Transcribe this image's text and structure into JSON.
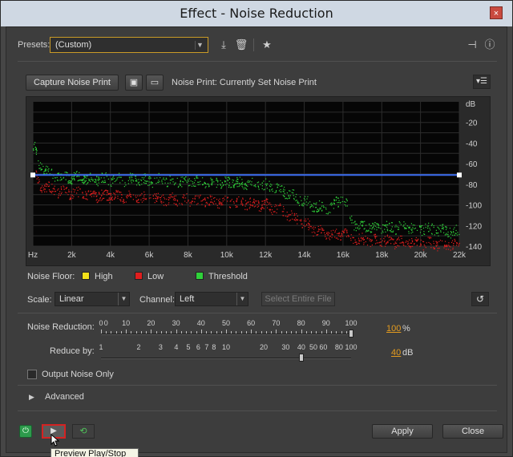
{
  "window": {
    "title": "Effect - Noise Reduction",
    "close_glyph": "×"
  },
  "presets": {
    "label": "Presets:",
    "selected": "(Custom)",
    "icons": [
      "save-preset-icon",
      "delete-preset-icon",
      "favorite-star-icon",
      "routing-icon",
      "info-icon"
    ]
  },
  "capture": {
    "button_label": "Capture Noise Print",
    "noise_print_label": "Noise Print: Currently Set Noise Print"
  },
  "colors": {
    "high": "#f2e01a",
    "low": "#e01e1e",
    "threshold": "#2fd13a",
    "curve": "#3a6cf0",
    "accent_value": "#e39b1f"
  },
  "chart_data": {
    "type": "scatter",
    "x_label_ticks": [
      "Hz",
      "2k",
      "4k",
      "6k",
      "8k",
      "10k",
      "12k",
      "14k",
      "16k",
      "18k",
      "20k",
      "22k"
    ],
    "y_unit": "dB",
    "y_ticks": [
      "-20",
      "-40",
      "-60",
      "-80",
      "-100",
      "-120",
      "-140"
    ],
    "ylim": [
      -140,
      0
    ],
    "xlim": [
      0,
      22000
    ],
    "grid": true,
    "series": [
      {
        "name": "Threshold",
        "color": "#2fd13a",
        "x_khz": [
          0.1,
          0.3,
          0.6,
          1,
          1.5,
          2,
          3,
          4,
          5,
          6,
          7,
          8,
          9,
          10,
          11,
          12,
          12.5,
          13,
          13.5,
          14,
          14.5,
          15,
          15.5,
          16,
          16.5,
          17,
          18,
          19,
          20,
          21,
          22
        ],
        "db": [
          -45,
          -60,
          -65,
          -70,
          -72,
          -73,
          -74,
          -75,
          -75,
          -76,
          -76,
          -77,
          -77,
          -78,
          -79,
          -81,
          -83,
          -87,
          -92,
          -97,
          -100,
          -104,
          -100,
          -92,
          -118,
          -120,
          -122,
          -121,
          -122,
          -124,
          -126
        ]
      },
      {
        "name": "Low",
        "color": "#e01e1e",
        "x_khz": [
          0.1,
          0.3,
          0.6,
          1,
          1.5,
          2,
          3,
          4,
          5,
          6,
          7,
          8,
          9,
          10,
          11,
          12,
          12.5,
          13,
          13.5,
          14,
          14.5,
          15,
          15.5,
          16,
          16.5,
          17,
          18,
          19,
          20,
          21,
          22
        ],
        "db": [
          -70,
          -80,
          -82,
          -85,
          -87,
          -88,
          -90,
          -91,
          -92,
          -93,
          -94,
          -95,
          -96,
          -97,
          -98,
          -100,
          -103,
          -107,
          -112,
          -118,
          -124,
          -128,
          -130,
          -126,
          -132,
          -134,
          -135,
          -136,
          -137,
          -138,
          -139
        ]
      },
      {
        "name": "High",
        "color": "#f2e01a",
        "x_khz": [],
        "db": []
      },
      {
        "name": "Noise Reduction Curve",
        "color": "#3a6cf0",
        "x_khz": [
          0,
          22
        ],
        "db": [
          -71,
          -71
        ]
      }
    ]
  },
  "legend": {
    "noise_floor_label": "Noise Floor:",
    "high": "High",
    "low": "Low",
    "threshold": "Threshold"
  },
  "controls": {
    "scale_label": "Scale:",
    "scale_value": "Linear",
    "channel_label": "Channel:",
    "channel_value": "Left",
    "select_entire_file": "Select Entire File"
  },
  "noise_reduction": {
    "label": "Noise Reduction:",
    "ticks": [
      "0",
      "0",
      "10",
      "20",
      "30",
      "40",
      "50",
      "60",
      "70",
      "80",
      "90",
      "100"
    ],
    "value": "100",
    "unit": "%",
    "fraction": 1.0
  },
  "reduce_by": {
    "label": "Reduce by:",
    "ticks": [
      "1",
      "2",
      "3",
      "4",
      "5",
      "6",
      "7",
      "8",
      "10",
      "20",
      "30",
      "40",
      "50",
      "60",
      "80",
      "100"
    ],
    "value": "40",
    "unit": "dB",
    "fraction": 0.8
  },
  "output_noise_only": {
    "label": "Output Noise Only",
    "checked": false
  },
  "advanced": {
    "label": "Advanced"
  },
  "footer": {
    "apply": "Apply",
    "close": "Close",
    "tooltip": "Preview Play/Stop"
  }
}
